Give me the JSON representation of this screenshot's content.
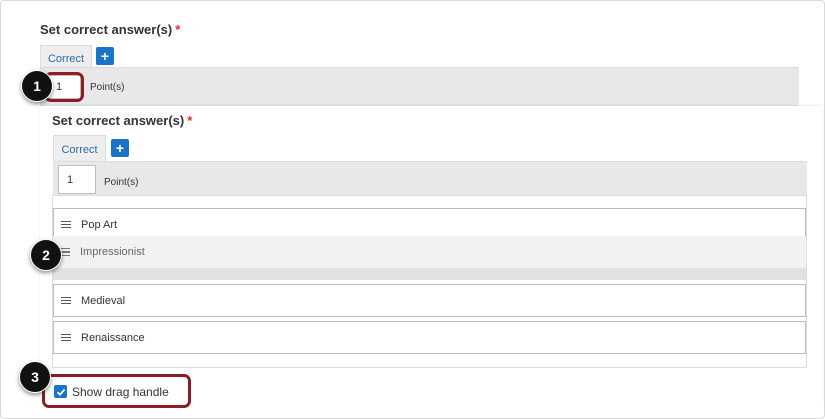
{
  "back_panel": {
    "heading": "Set correct answer(s)",
    "required_mark": "*",
    "tab_label": "Correct",
    "add_tab_symbol": "+",
    "points_value": "1",
    "points_label": "Point(s)"
  },
  "front_panel": {
    "heading": "Set correct answer(s)",
    "required_mark": "*",
    "tab_label": "Correct",
    "add_tab_symbol": "+",
    "points_value": "1",
    "points_label": "Point(s)",
    "items": [
      {
        "label": "Pop Art"
      },
      {
        "label": "Impressionist"
      },
      {
        "label": "Medieval"
      },
      {
        "label": "Renaissance"
      }
    ],
    "show_drag_handle": {
      "label": "Show drag handle",
      "checked": true
    }
  },
  "callouts": [
    "1",
    "2",
    "3"
  ],
  "colors": {
    "accent_blue": "#1a73c4",
    "callout_border": "#8b1e24",
    "required_red": "#d9302c"
  }
}
